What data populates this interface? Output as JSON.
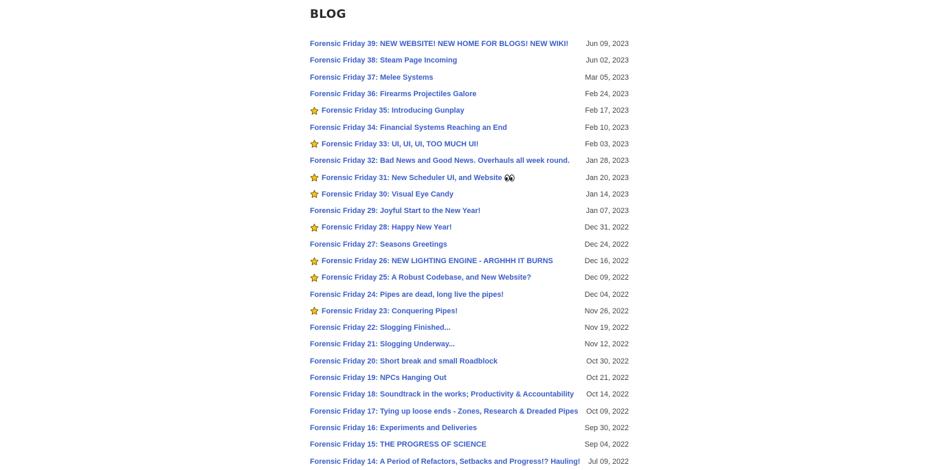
{
  "page": {
    "title": "BLOG"
  },
  "posts": [
    {
      "title": "Forensic Friday 39: NEW WEBSITE! NEW HOME FOR BLOGS! NEW WIKI!",
      "date": "Jun 09, 2023",
      "starred": false,
      "eyes": false
    },
    {
      "title": "Forensic Friday 38: Steam Page Incoming",
      "date": "Jun 02, 2023",
      "starred": false,
      "eyes": false
    },
    {
      "title": "Forensic Friday 37: Melee Systems",
      "date": "Mar 05, 2023",
      "starred": false,
      "eyes": false
    },
    {
      "title": "Forensic Friday 36: Firearms Projectiles Galore",
      "date": "Feb 24, 2023",
      "starred": false,
      "eyes": false
    },
    {
      "title": "Forensic Friday 35: Introducing Gunplay",
      "date": "Feb 17, 2023",
      "starred": true,
      "eyes": false
    },
    {
      "title": "Forensic Friday 34: Financial Systems Reaching an End",
      "date": "Feb 10, 2023",
      "starred": false,
      "eyes": false
    },
    {
      "title": "Forensic Friday 33: UI, UI, UI, TOO MUCH UI!",
      "date": "Feb 03, 2023",
      "starred": true,
      "eyes": false
    },
    {
      "title": "Forensic Friday 32: Bad News and Good News. Overhauls all week round.",
      "date": "Jan 28, 2023",
      "starred": false,
      "eyes": false
    },
    {
      "title": "Forensic Friday 31: New Scheduler UI, and Website",
      "date": "Jan 20, 2023",
      "starred": true,
      "eyes": true
    },
    {
      "title": "Forensic Friday 30: Visual Eye Candy",
      "date": "Jan 14, 2023",
      "starred": true,
      "eyes": false
    },
    {
      "title": "Forensic Friday 29: Joyful Start to the New Year!",
      "date": "Jan 07, 2023",
      "starred": false,
      "eyes": false
    },
    {
      "title": "Forensic Friday 28: Happy New Year!",
      "date": "Dec 31, 2022",
      "starred": true,
      "eyes": false
    },
    {
      "title": "Forensic Friday 27: Seasons Greetings",
      "date": "Dec 24, 2022",
      "starred": false,
      "eyes": false
    },
    {
      "title": "Forensic Friday 26: NEW LIGHTING ENGINE - ARGHHH IT BURNS",
      "date": "Dec 16, 2022",
      "starred": true,
      "eyes": false
    },
    {
      "title": "Forensic Friday 25: A Robust Codebase, and New Website?",
      "date": "Dec 09, 2022",
      "starred": true,
      "eyes": false
    },
    {
      "title": "Forensic Friday 24: Pipes are dead, long live the pipes!",
      "date": "Dec 04, 2022",
      "starred": false,
      "eyes": false
    },
    {
      "title": "Forensic Friday 23: Conquering Pipes!",
      "date": "Nov 26, 2022",
      "starred": true,
      "eyes": false
    },
    {
      "title": "Forensic Friday 22: Slogging Finished...",
      "date": "Nov 19, 2022",
      "starred": false,
      "eyes": false
    },
    {
      "title": "Forensic Friday 21: Slogging Underway...",
      "date": "Nov 12, 2022",
      "starred": false,
      "eyes": false
    },
    {
      "title": "Forensic Friday 20: Short break and small Roadblock",
      "date": "Oct 30, 2022",
      "starred": false,
      "eyes": false
    },
    {
      "title": "Forensic Friday 19: NPCs Hanging Out",
      "date": "Oct 21, 2022",
      "starred": false,
      "eyes": false
    },
    {
      "title": "Forensic Friday 18: Soundtrack in the works; Productivity & Accountability",
      "date": "Oct 14, 2022",
      "starred": false,
      "eyes": false
    },
    {
      "title": "Forensic Friday 17: Tying up loose ends - Zones, Research & Dreaded Pipes",
      "date": "Oct 09, 2022",
      "starred": false,
      "eyes": false
    },
    {
      "title": "Forensic Friday 16: Experiments and Deliveries",
      "date": "Sep 30, 2022",
      "starred": false,
      "eyes": false
    },
    {
      "title": "Forensic Friday 15: THE PROGRESS OF SCIENCE",
      "date": "Sep 04, 2022",
      "starred": false,
      "eyes": false
    },
    {
      "title": "Forensic Friday 14: A Period of Refactors, Setbacks and Progress!? Hauling!",
      "date": "Jul 09, 2022",
      "starred": false,
      "eyes": false
    }
  ],
  "icons": {
    "star": "star-icon",
    "eyes": "eyes-icon"
  },
  "colors": {
    "link": "#3b5ec8",
    "date": "#444444",
    "title": "#2b2b2b",
    "star_fill": "#f5c518",
    "star_stroke": "#6b5200"
  }
}
